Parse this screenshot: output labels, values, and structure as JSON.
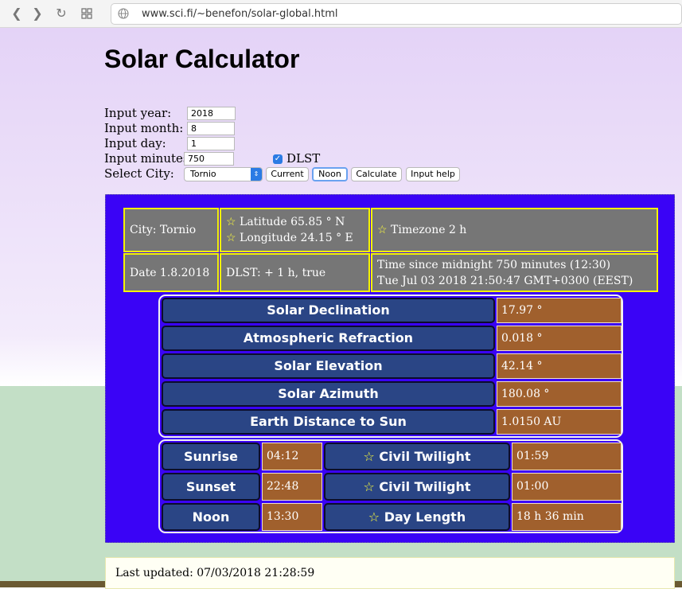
{
  "browser": {
    "url": "www.sci.fi/~benefon/solar-global.html"
  },
  "page": {
    "title": "Solar Calculator"
  },
  "form": {
    "year_label": "Input year:",
    "year_value": "2018",
    "month_label": "Input month:",
    "month_value": "8",
    "day_label": "Input day:",
    "day_value": "1",
    "minutes_label": "Input minutes:",
    "minutes_value": "750",
    "dlst_label": "DLST",
    "dlst_checked": true,
    "city_label": "Select City:",
    "city_value": "Tornio",
    "buttons": {
      "current": "Current",
      "noon": "Noon",
      "calculate": "Calculate",
      "help": "Input help"
    }
  },
  "info": {
    "city": "City: Tornio",
    "latitude": "Latitude 65.85 ° N",
    "longitude": "Longitude 24.15 ° E",
    "timezone": "Timezone 2 h",
    "date": "Date 1.8.2018",
    "dlst": "DLST: + 1 h, true",
    "time_line1": "Time since midnight 750 minutes (12:30)",
    "time_line2": "Tue Jul 03 2018 21:50:47 GMT+0300 (EEST)",
    "star_glyph": "☆"
  },
  "solar": [
    {
      "label": "Solar Declination",
      "value": "17.97 °"
    },
    {
      "label": "Atmospheric Refraction",
      "value": "0.018 °"
    },
    {
      "label": "Solar Elevation",
      "value": "42.14 °"
    },
    {
      "label": "Solar Azimuth",
      "value": "180.08 °"
    },
    {
      "label": "Earth Distance to Sun",
      "value": "1.0150 AU"
    }
  ],
  "times": [
    {
      "label": "Sunrise",
      "value": "04:12",
      "label2": "Civil Twilight",
      "value2": "01:59"
    },
    {
      "label": "Sunset",
      "value": "22:48",
      "label2": "Civil Twilight",
      "value2": "01:00"
    },
    {
      "label": "Noon",
      "value": "13:30",
      "label2": "Day Length",
      "value2": "18 h 36 min"
    }
  ],
  "footer": {
    "last_updated": "Last updated: 07/03/2018 21:28:59"
  },
  "colors": {
    "panel_bg": "#3a03f6",
    "label_bg": "#2a4585",
    "value_bg": "#a0602d",
    "info_bg": "#767676",
    "info_border": "#f4f400"
  }
}
